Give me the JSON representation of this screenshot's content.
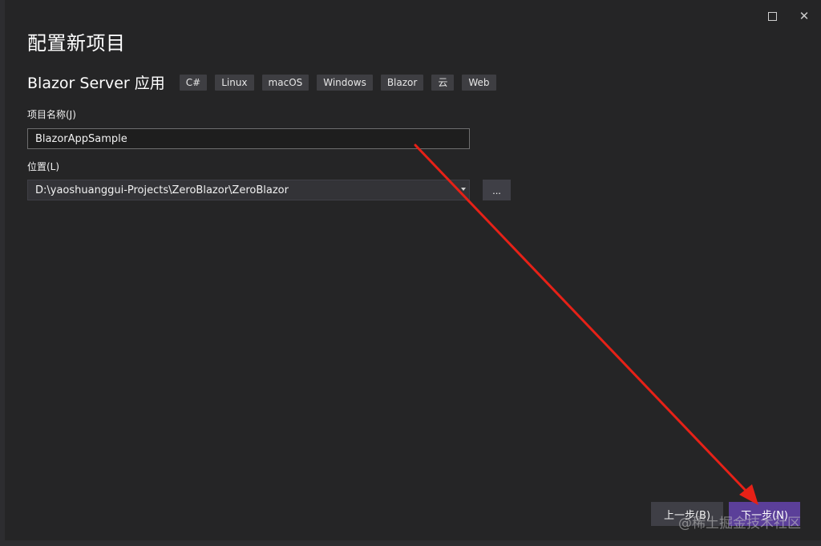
{
  "window": {
    "maximize_icon": "maximize-icon",
    "close_glyph": "✕"
  },
  "page": {
    "title": "配置新项目"
  },
  "template": {
    "name": "Blazor Server 应用",
    "tags": [
      "C#",
      "Linux",
      "macOS",
      "Windows",
      "Blazor",
      "云",
      "Web"
    ]
  },
  "project_name": {
    "label": "项目名称(J)",
    "value": "BlazorAppSample"
  },
  "location": {
    "label": "位置(L)",
    "value": "D:\\yaoshuanggui-Projects\\ZeroBlazor\\ZeroBlazor",
    "browse_label": "..."
  },
  "footer": {
    "back_label": "上一步(B)",
    "next_label": "下一步(N)"
  },
  "watermark": "@稀土掘金技术社区",
  "colors": {
    "background": "#252526",
    "accent": "#5b3f99",
    "arrow": "#e62117"
  }
}
